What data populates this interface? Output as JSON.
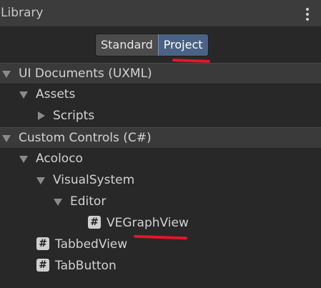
{
  "header": {
    "title": "Library",
    "menu_icon": "kebab-menu-icon"
  },
  "toggle": {
    "options": [
      "Standard",
      "Project"
    ],
    "selected": "Project"
  },
  "tree": {
    "ui_documents": {
      "label": "UI Documents (UXML)",
      "assets": {
        "label": "Assets",
        "scripts": {
          "label": "Scripts"
        }
      }
    },
    "custom_controls": {
      "label": "Custom Controls (C#)",
      "acoloco": {
        "label": "Acoloco",
        "visual_system": {
          "label": "VisualSystem",
          "editor": {
            "label": "Editor",
            "items": [
              {
                "label": "VEGraphView",
                "icon": "csharp-script-icon"
              }
            ]
          }
        }
      },
      "items": [
        {
          "label": "TabbedView",
          "icon": "csharp-script-icon"
        },
        {
          "label": "TabButton",
          "icon": "csharp-script-icon"
        }
      ]
    },
    "hash_glyph": "#"
  },
  "colors": {
    "background": "#282828",
    "header": "#3c3c3c",
    "active_toggle": "#4a6283",
    "annotation_red": "#e3162b"
  }
}
